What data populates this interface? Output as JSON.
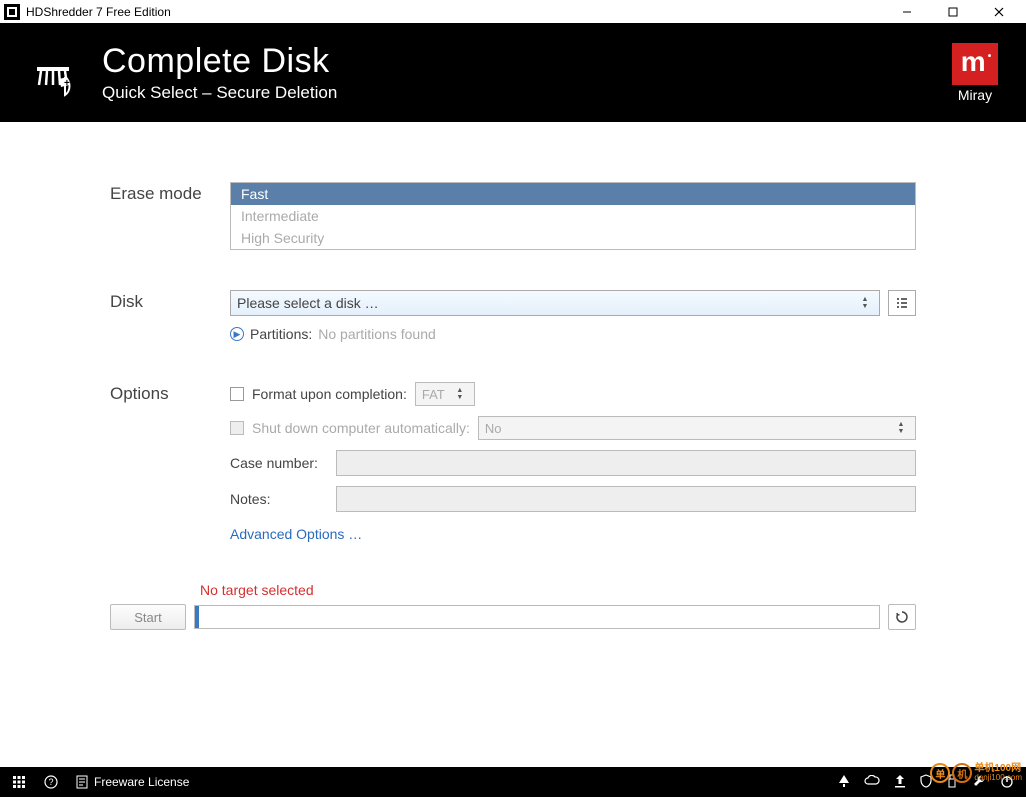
{
  "titlebar": {
    "title": "HDShredder 7 Free Edition"
  },
  "header": {
    "title": "Complete Disk",
    "subtitle": "Quick Select – Secure Deletion",
    "brand": "Miray"
  },
  "sections": {
    "erase_mode": {
      "label": "Erase mode",
      "options": [
        "Fast",
        "Intermediate",
        "High Security"
      ],
      "selected": "Fast"
    },
    "disk": {
      "label": "Disk",
      "placeholder": "Please select a disk …",
      "partitions_label": "Partitions:",
      "partitions_value": "No partitions found"
    },
    "options": {
      "label": "Options",
      "format_label": "Format upon completion:",
      "format_value": "FAT",
      "shutdown_label": "Shut down computer automatically:",
      "shutdown_value": "No",
      "case_label": "Case number:",
      "case_value": "",
      "notes_label": "Notes:",
      "notes_value": "",
      "advanced_link": "Advanced Options …"
    }
  },
  "action": {
    "status": "No target selected",
    "start_label": "Start"
  },
  "footer": {
    "license": "Freeware License"
  },
  "watermark": {
    "brand": "单机100网",
    "url": "danji100.com"
  }
}
